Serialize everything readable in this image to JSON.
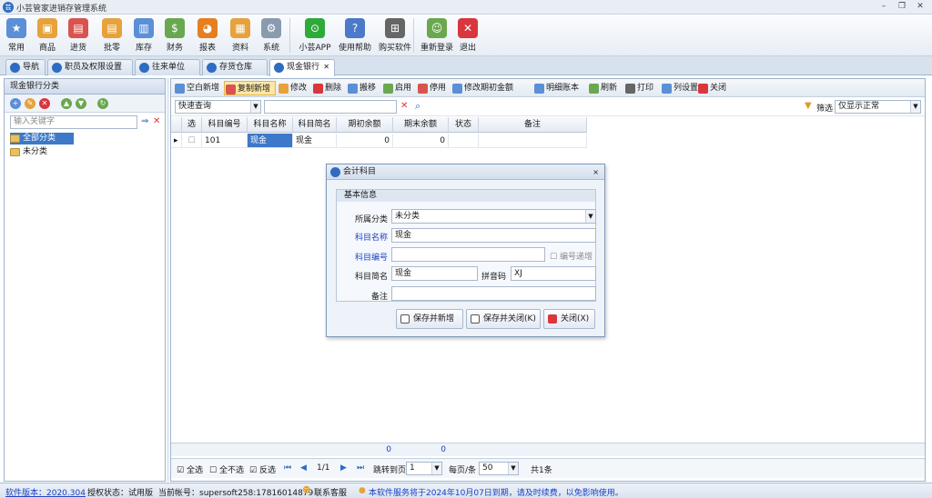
{
  "window": {
    "title": "小芸管家进销存管理系统",
    "min": "–",
    "restore": "❐",
    "close": "✕"
  },
  "ribbon": [
    {
      "label": "常用",
      "icon": "star-icon",
      "color": "#5b8fd6",
      "glyph": "★"
    },
    {
      "label": "商品",
      "icon": "box-icon",
      "color": "#e6a23c",
      "glyph": "▣"
    },
    {
      "label": "进货",
      "icon": "purchase-icon",
      "color": "#d9534f",
      "glyph": "▤"
    },
    {
      "label": "批零",
      "icon": "wholesale-icon",
      "color": "#e6a23c",
      "glyph": "▤"
    },
    {
      "label": "库存",
      "icon": "inventory-icon",
      "color": "#5b8fd6",
      "glyph": "▥"
    },
    {
      "label": "财务",
      "icon": "finance-icon",
      "color": "#6aa84f",
      "glyph": "$"
    },
    {
      "label": "报表",
      "icon": "report-pie-icon",
      "color": "#e67e22",
      "glyph": "◕"
    },
    {
      "label": "资料",
      "icon": "data-icon",
      "color": "#e6a23c",
      "glyph": "▦"
    },
    {
      "label": "系统",
      "icon": "system-gear-icon",
      "color": "#8a9bb0",
      "glyph": "⚙"
    },
    {
      "label": "小芸APP",
      "icon": "app-icon",
      "color": "#2eaa3a",
      "glyph": "⊙"
    },
    {
      "label": "使用帮助",
      "icon": "help-icon",
      "color": "#4a7ac9",
      "glyph": "?"
    },
    {
      "label": "购买软件",
      "icon": "cart-icon",
      "color": "#666666",
      "glyph": "⊞"
    },
    {
      "label": "重新登录",
      "icon": "relogin-user-icon",
      "color": "#6aa84f",
      "glyph": "☺"
    },
    {
      "label": "退出",
      "icon": "exit-icon",
      "color": "#d9363e",
      "glyph": "✕"
    }
  ],
  "tabs": [
    {
      "label": "导航"
    },
    {
      "label": "职员及权限设置"
    },
    {
      "label": "往来单位"
    },
    {
      "label": "存货仓库"
    },
    {
      "label": "现金银行",
      "close": "✕"
    }
  ],
  "left": {
    "title": "现金银行分类",
    "search_placeholder": "输入关键字",
    "tree": [
      "全部分类",
      "未分类"
    ]
  },
  "toolbar": [
    {
      "label": "空白新增",
      "color": "#5b8fd6"
    },
    {
      "label": "复制新增",
      "color": "#d9534f"
    },
    {
      "label": "修改",
      "color": "#e6a23c"
    },
    {
      "label": "删除",
      "color": "#d9363e"
    },
    {
      "label": "搬移",
      "color": "#5b8fd6"
    },
    {
      "label": "启用",
      "color": "#6aa84f"
    },
    {
      "label": "停用",
      "color": "#d9534f"
    },
    {
      "label": "修改期初金额",
      "color": "#5b8fd6"
    },
    {
      "label": "明细账本",
      "color": "#5b8fd6"
    },
    {
      "label": "刷新",
      "color": "#6aa84f"
    },
    {
      "label": "打印",
      "color": "#666666"
    },
    {
      "label": "列设置",
      "color": "#5b8fd6"
    },
    {
      "label": "关闭",
      "color": "#d9363e"
    }
  ],
  "query": {
    "mode": "快速查询",
    "filter_label": "筛选",
    "filter_value": "仅显示正常"
  },
  "grid": {
    "columns": [
      "选",
      "科目编号",
      "科目名称",
      "科目简名",
      "期初余额",
      "期末余额",
      "状态",
      "备注"
    ],
    "rows": [
      [
        "",
        "101",
        "现金",
        "现金",
        "0",
        "0",
        "",
        ""
      ]
    ],
    "totals": [
      "0",
      "0"
    ]
  },
  "pager": {
    "select_all": "全选",
    "select_none": "全不选",
    "invert": "反选",
    "page": "1/1",
    "jump_label": "跳转到页",
    "jump_value": "1",
    "per_page_label": "每页/条",
    "per_page_value": "50",
    "total": "共1条"
  },
  "status": {
    "version": "软件版本：2020.304",
    "license": "授权状态：试用版",
    "account": "当前帐号：supersoft258:17816014879",
    "support": "联系客服",
    "notice": "本软件服务将于2024年10月07日到期，请及时续费，以免影响使用。"
  },
  "dialog": {
    "title": "会计科目",
    "group": "基本信息",
    "category_label": "所属分类",
    "category_value": "未分类",
    "name_label": "科目名称",
    "name_value": "现金",
    "code_label": "科目编号",
    "code_value": "",
    "auto_code_label": "编号递增",
    "short_label": "科目简名",
    "short_value": "现金",
    "pinyin_label": "拼音码",
    "pinyin_value": "XJ",
    "note_label": "备注",
    "note_value": "",
    "btn_save_new": "保存并新增",
    "btn_save_close": "保存并关闭(K)",
    "btn_close": "关闭(X)"
  }
}
